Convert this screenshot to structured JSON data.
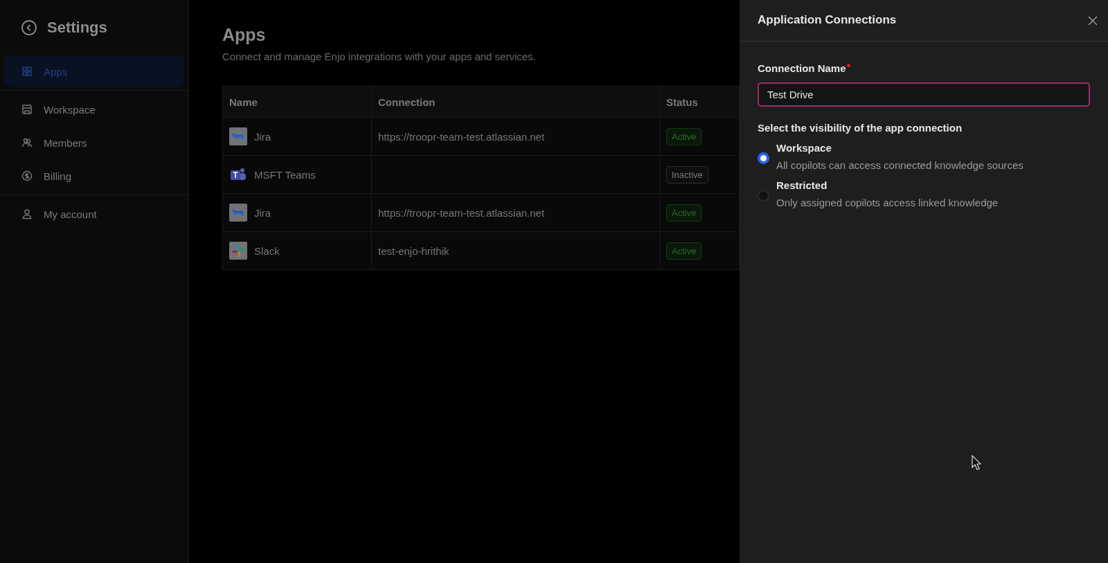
{
  "sidebar": {
    "title": "Settings",
    "items": [
      {
        "label": "Apps",
        "selected": true
      },
      {
        "label": "Workspace",
        "selected": false
      },
      {
        "label": "Members",
        "selected": false
      },
      {
        "label": "Billing",
        "selected": false
      },
      {
        "label": "My account",
        "selected": false
      }
    ]
  },
  "page": {
    "title": "Apps",
    "subtitle": "Connect and manage Enjo integrations with your apps and services."
  },
  "table": {
    "columns": [
      "Name",
      "Connection",
      "Status"
    ],
    "rows": [
      {
        "kind": "jira",
        "name": "Jira",
        "connection": "https://troopr-team-test.atlassian.net",
        "status": {
          "label": "Active",
          "kind": "active"
        }
      },
      {
        "kind": "teams",
        "name": "MSFT Teams",
        "status": {
          "label": "Inactive",
          "kind": "inactive"
        }
      },
      {
        "kind": "jira",
        "name": "Jira",
        "connection": "https://troopr-team-test.atlassian.net",
        "status": {
          "label": "Active",
          "kind": "active"
        }
      },
      {
        "kind": "slack",
        "name": "Slack",
        "connection": "test-enjo-hrithik",
        "status": {
          "label": "Active",
          "kind": "active"
        }
      }
    ]
  },
  "drawer": {
    "title": "Application Connections",
    "field": {
      "label": "Connection Name",
      "required": true,
      "value": "Test Drive"
    },
    "visibility": {
      "heading": "Select the visibility of the app connection",
      "options": [
        {
          "label": "Workspace",
          "description": "All copilots can access connected knowledge sources",
          "selected": true
        },
        {
          "label": "Restricted",
          "description": "Only assigned copilots access linked knowledge",
          "selected": false
        }
      ]
    }
  }
}
